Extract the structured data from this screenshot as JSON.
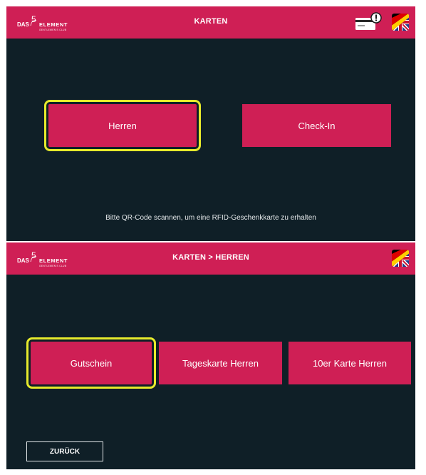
{
  "screen1": {
    "title": "KARTEN",
    "buttons": [
      "Herren",
      "Check-In"
    ],
    "selected_button": "Herren",
    "hint": "Bitte QR-Code scannen, um eine RFID-Geschenkkarte zu erhalten",
    "icons": [
      "card-alert-icon",
      "flag-de-uk-icon"
    ]
  },
  "screen2": {
    "title": "KARTEN > HERREN",
    "buttons": [
      "Gutschein",
      "Tageskarte Herren",
      "10er Karte Herren"
    ],
    "selected_button": "Gutschein",
    "back_label": "ZURÜCK",
    "icons": [
      "flag-de-uk-icon"
    ]
  },
  "logo": {
    "brand_left": "DAS",
    "brand_number": "5",
    "brand_right": "ELEMENT",
    "tagline": "GENTLEMEN'S CLUB"
  },
  "colors": {
    "accent": "#cf1f55",
    "background": "#0f1f27",
    "selection": "#e6ea2c"
  }
}
